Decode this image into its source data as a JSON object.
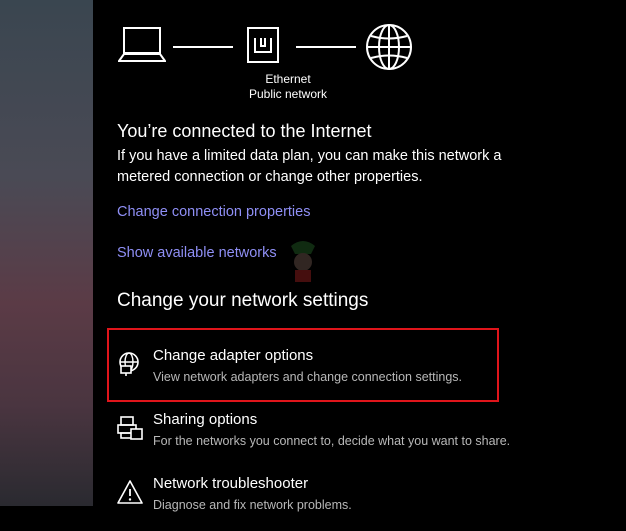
{
  "network": {
    "ethernet_label": "Ethernet",
    "network_type": "Public network"
  },
  "status": {
    "title": "You’re connected to the Internet",
    "description": "If you have a limited data plan, you can make this network a metered connection or change other properties."
  },
  "links": {
    "change_connection_properties": "Change connection properties",
    "show_available_networks": "Show available networks"
  },
  "section": {
    "title": "Change your network settings"
  },
  "options": [
    {
      "title": "Change adapter options",
      "subtitle": "View network adapters and change connection settings.",
      "icon": "adapter-globe-icon"
    },
    {
      "title": "Sharing options",
      "subtitle": "For the networks you connect to, decide what you want to share.",
      "icon": "sharing-icon"
    },
    {
      "title": "Network troubleshooter",
      "subtitle": "Diagnose and fix network problems.",
      "icon": "warning-icon"
    }
  ],
  "colors": {
    "link": "#8f8ff5",
    "highlight": "#e0151b",
    "background": "#000000"
  }
}
